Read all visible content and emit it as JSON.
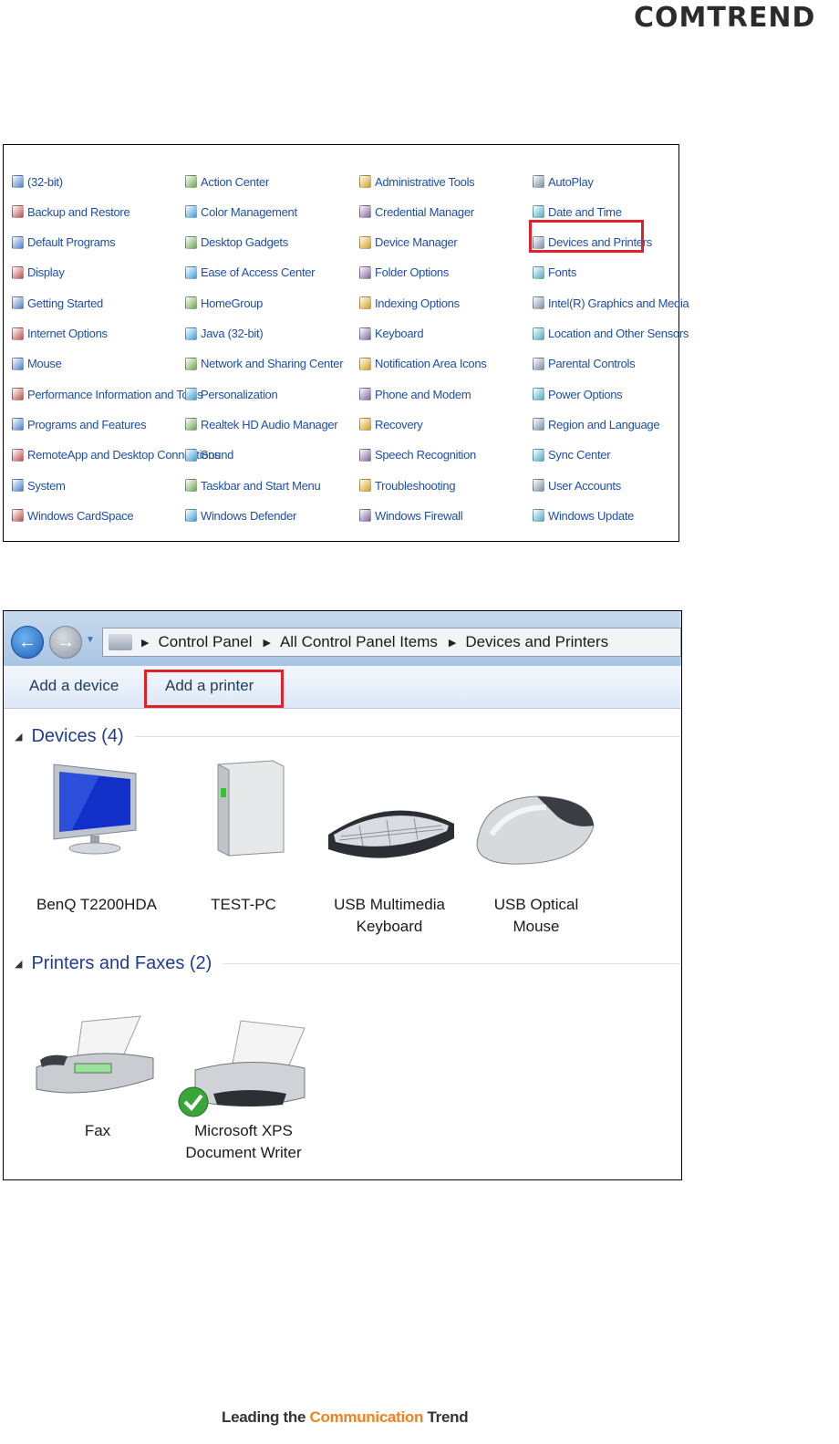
{
  "brand": {
    "logo_text": "COMTREND",
    "logo_color": "#2b2b2b"
  },
  "control_panel": {
    "items": [
      [
        "(32-bit)",
        "Action Center",
        "Administrative Tools",
        "AutoPlay"
      ],
      [
        "Backup and Restore",
        "Color Management",
        "Credential Manager",
        "Date and Time"
      ],
      [
        "Default Programs",
        "Desktop Gadgets",
        "Device Manager",
        "Devices and Printers"
      ],
      [
        "Display",
        "Ease of Access Center",
        "Folder Options",
        "Fonts"
      ],
      [
        "Getting Started",
        "HomeGroup",
        "Indexing Options",
        "Intel(R) Graphics and Media"
      ],
      [
        "Internet Options",
        "Java (32-bit)",
        "Keyboard",
        "Location and Other Sensors"
      ],
      [
        "Mouse",
        "Network and Sharing Center",
        "Notification Area Icons",
        "Parental Controls"
      ],
      [
        "Performance Information and Tools",
        "Personalization",
        "Phone and Modem",
        "Power Options"
      ],
      [
        "Programs and Features",
        "Realtek HD Audio Manager",
        "Recovery",
        "Region and Language"
      ],
      [
        "RemoteApp and Desktop Connections",
        "Sound",
        "Speech Recognition",
        "Sync Center"
      ],
      [
        "System",
        "Taskbar and Start Menu",
        "Troubleshooting",
        "User Accounts"
      ],
      [
        "Windows CardSpace",
        "Windows Defender",
        "Windows Firewall",
        "Windows Update"
      ]
    ],
    "highlighted": "Devices and Printers",
    "link_color": "#1d4fa8",
    "highlight_color": "#e0202a"
  },
  "devices_window": {
    "breadcrumb": [
      "Control Panel",
      "All Control Panel Items",
      "Devices and Printers"
    ],
    "toolbar": {
      "add_device": "Add a device",
      "add_printer": "Add a printer"
    },
    "groups": {
      "devices": {
        "header": "Devices (4)",
        "items": [
          {
            "label": "BenQ T2200HDA",
            "icon": "monitor-icon"
          },
          {
            "label": "TEST-PC",
            "icon": "pc-tower-icon"
          },
          {
            "label": "USB Multimedia Keyboard",
            "icon": "keyboard-icon"
          },
          {
            "label": "USB Optical Mouse",
            "icon": "mouse-icon"
          }
        ]
      },
      "printers": {
        "header": "Printers and Faxes (2)",
        "items": [
          {
            "label": "Fax",
            "icon": "fax-icon"
          },
          {
            "label": "Microsoft XPS Document Writer",
            "icon": "printer-icon",
            "default": true
          }
        ]
      }
    }
  },
  "footer": {
    "pre": "Leading the ",
    "highlight": "Communication",
    "post": " Trend",
    "highlight_color": "#f2811d"
  }
}
